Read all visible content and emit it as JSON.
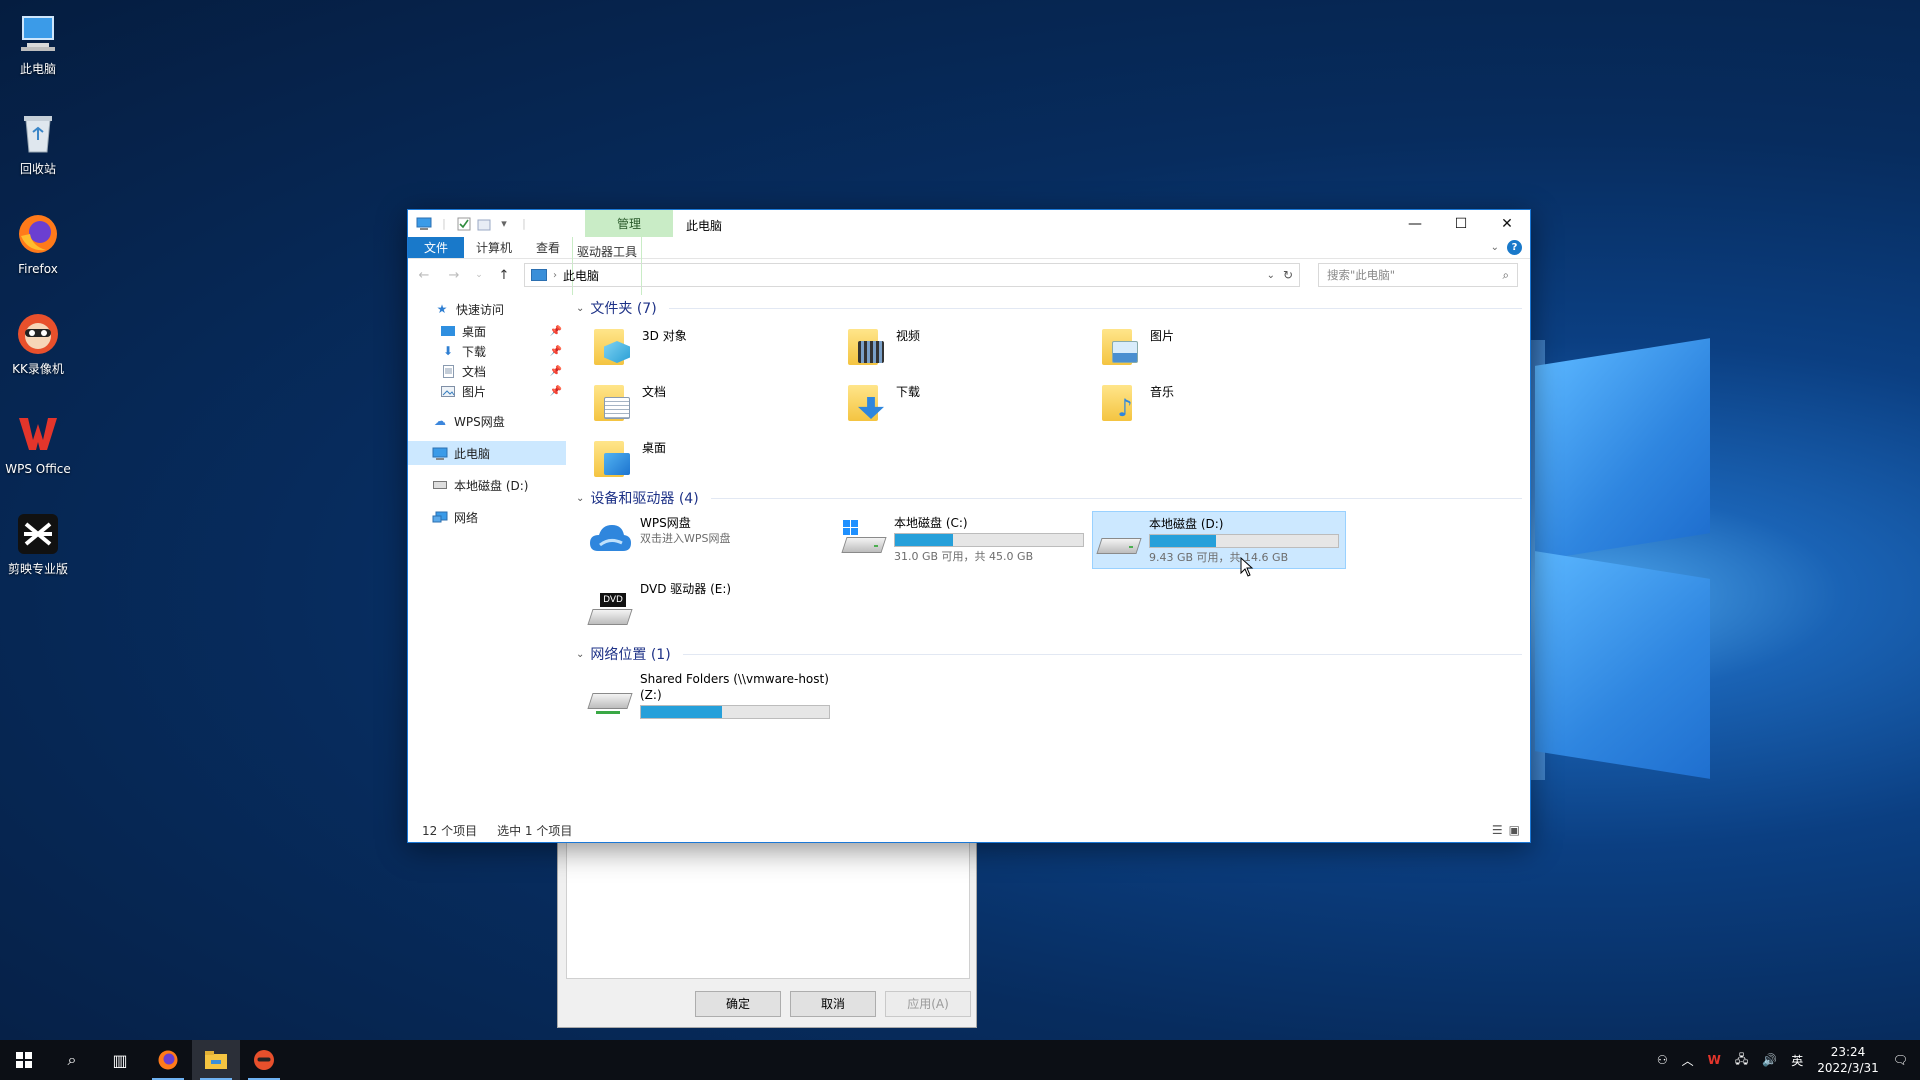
{
  "desktop": {
    "icons": [
      {
        "label": "此电脑",
        "icon": "computer-icon"
      },
      {
        "label": "回收站",
        "icon": "recycle-bin-icon"
      },
      {
        "label": "Firefox",
        "icon": "firefox-icon"
      },
      {
        "label": "KK录像机",
        "icon": "kk-recorder-icon"
      },
      {
        "label": "WPS Office",
        "icon": "wps-office-icon"
      },
      {
        "label": "剪映专业版",
        "icon": "capcut-icon"
      }
    ]
  },
  "window": {
    "title": "此电脑",
    "context_tab": "管理",
    "ribbon_tabs": [
      "文件",
      "计算机",
      "查看",
      "驱动器工具"
    ],
    "address": {
      "path": "此电脑"
    },
    "search": {
      "placeholder": "搜索\"此电脑\""
    },
    "nav": {
      "quick_access": "快速访问",
      "items": [
        {
          "label": "桌面",
          "pinned": true
        },
        {
          "label": "下载",
          "pinned": true
        },
        {
          "label": "文档",
          "pinned": true
        },
        {
          "label": "图片",
          "pinned": true
        }
      ],
      "wps_cloud": "WPS网盘",
      "this_pc": "此电脑",
      "local_d": "本地磁盘 (D:)",
      "network": "网络"
    },
    "groups": {
      "folders": "文件夹 (7)",
      "drives": "设备和驱动器 (4)",
      "network_locations": "网络位置 (1)"
    },
    "folders": [
      {
        "label": "3D 对象",
        "icon": "3d-objects-icon"
      },
      {
        "label": "视频",
        "icon": "videos-icon"
      },
      {
        "label": "图片",
        "icon": "pictures-icon"
      },
      {
        "label": "文档",
        "icon": "documents-icon"
      },
      {
        "label": "下载",
        "icon": "downloads-icon"
      },
      {
        "label": "音乐",
        "icon": "music-icon"
      },
      {
        "label": "桌面",
        "icon": "desktop-icon"
      }
    ],
    "drives": [
      {
        "name": "WPS网盘",
        "sub": "双击进入WPS网盘",
        "icon": "cloud-drive-icon"
      },
      {
        "name": "本地磁盘 (C:)",
        "sub": "31.0 GB 可用，共 45.0 GB",
        "used_fraction": 0.31,
        "icon": "windows-drive-icon"
      },
      {
        "name": "本地磁盘 (D:)",
        "sub": "9.43 GB 可用，共 14.6 GB",
        "used_fraction": 0.35,
        "icon": "hard-drive-icon",
        "selected": true
      },
      {
        "name": "DVD 驱动器 (E:)",
        "icon": "dvd-drive-icon",
        "badge": "DVD"
      }
    ],
    "network_location": {
      "name": "Shared Folders (\\\\vmware-host)",
      "name2": "(Z:)",
      "used_fraction": 0.43
    },
    "status": {
      "count": "12 个项目",
      "selected": "选中 1 个项目"
    }
  },
  "dialog": {
    "ok": "确定",
    "cancel": "取消",
    "apply": "应用(A)"
  },
  "taskbar": {
    "tray_ime": "英",
    "time": "23:24",
    "date": "2022/3/31"
  },
  "colors": {
    "accent": "#1979ca",
    "selection": "#cce8ff",
    "bar_fill": "#26a0da",
    "context_tab": "#c9ecc6"
  }
}
